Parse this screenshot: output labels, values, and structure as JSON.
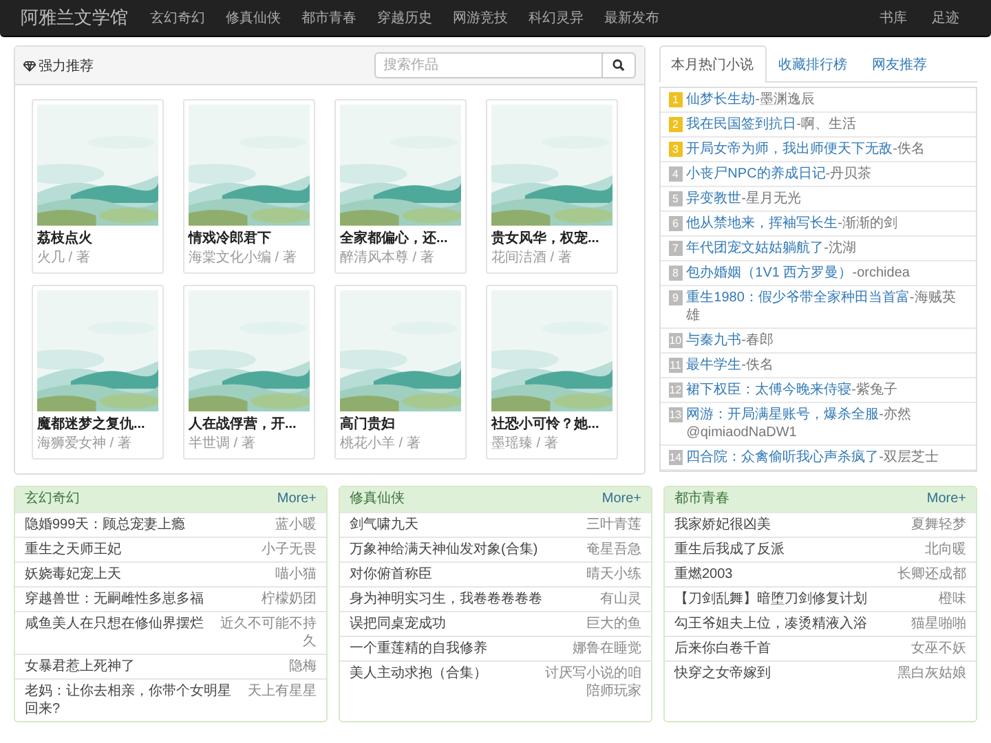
{
  "navbar": {
    "brand": "阿雅兰文学馆",
    "links": [
      "玄幻奇幻",
      "修真仙侠",
      "都市青春",
      "穿越历史",
      "网游竞技",
      "科幻灵异",
      "最新发布"
    ],
    "right_links": [
      "书库",
      "足迹"
    ]
  },
  "recommend": {
    "title": "强力推荐",
    "search": {
      "placeholder": "搜索作品"
    },
    "books": [
      {
        "title": "荔枝点火",
        "author": "火几 / 著"
      },
      {
        "title": "情戏冷郎君下",
        "author": "海棠文化小编 / 著"
      },
      {
        "title": "全家都偏心，还...",
        "author": "醉清风本尊 / 著"
      },
      {
        "title": "贵女风华，权宠...",
        "author": "花间洁酒 / 著"
      },
      {
        "title": "魔都迷梦之复仇...",
        "author": "海狮爱女神 / 著"
      },
      {
        "title": "人在战俘营，开...",
        "author": "半世调 / 著"
      },
      {
        "title": "高门贵妇",
        "author": "桃花小羊 / 著"
      },
      {
        "title": "社恐小可怜？她...",
        "author": "墨瑶臻 / 著"
      }
    ]
  },
  "ranking": {
    "tabs": [
      {
        "label": "本月热门小说",
        "selected": true
      },
      {
        "label": "收藏排行榜",
        "selected": false
      },
      {
        "label": "网友推荐",
        "selected": false
      }
    ],
    "items": [
      {
        "rank": "1",
        "color": "#f0c020",
        "title": "仙梦长生劫",
        "author": "-墨渊逸辰"
      },
      {
        "rank": "2",
        "color": "#f0c020",
        "title": "我在民国签到抗日",
        "author": "-啊、生活"
      },
      {
        "rank": "3",
        "color": "#f0c020",
        "title": "开局女帝为师，我出师便天下无敌",
        "author": "-佚名"
      },
      {
        "rank": "4",
        "color": "#bbbbbb",
        "title": "小丧尸NPC的养成日记",
        "author": "-丹贝茶"
      },
      {
        "rank": "5",
        "color": "#bbbbbb",
        "title": "异变教世",
        "author": "-星月无光"
      },
      {
        "rank": "6",
        "color": "#bbbbbb",
        "title": "他从禁地来，挥袖写长生",
        "author": "-渐渐的剑"
      },
      {
        "rank": "7",
        "color": "#bbbbbb",
        "title": "年代团宠文姑姑躺航了",
        "author": "-沈湖"
      },
      {
        "rank": "8",
        "color": "#bbbbbb",
        "title": "包办婚姻（1V1 西方罗曼）",
        "author": "-orchidea"
      },
      {
        "rank": "9",
        "color": "#bbbbbb",
        "title": "重生1980：假少爷带全家种田当首富",
        "author": "-海贼英雄"
      },
      {
        "rank": "10",
        "color": "#bbbbbb",
        "title": "与秦九书",
        "author": "-春郎"
      },
      {
        "rank": "11",
        "color": "#bbbbbb",
        "title": "最牛学生",
        "author": "-佚名"
      },
      {
        "rank": "12",
        "color": "#bbbbbb",
        "title": "裙下权臣：太傅今晚来侍寝",
        "author": "-紫兔子"
      },
      {
        "rank": "13",
        "color": "#bbbbbb",
        "title": "网游：开局满星账号，爆杀全服",
        "author": "-亦然@qimiaodNaDW1"
      },
      {
        "rank": "14",
        "color": "#bbbbbb",
        "title": "四合院：众禽偷听我心声杀疯了",
        "author": "-双层芝士"
      }
    ]
  },
  "categories": [
    {
      "title": "玄幻奇幻",
      "more": "More+",
      "rows": [
        {
          "title": "隐婚999天：顾总宠妻上瘾",
          "author": "蓝小暖"
        },
        {
          "title": "重生之天师王妃",
          "author": "小子无畏"
        },
        {
          "title": "妖娆毒妃宠上天",
          "author": "喵小猫"
        },
        {
          "title": "穿越兽世：无嗣雌性多崽多福",
          "author": "柠檬奶团"
        },
        {
          "title": "咸鱼美人在只想在修仙界摆烂",
          "author": "近久不可能不持久"
        },
        {
          "title": "女暴君惹上死神了",
          "author": "隐梅"
        },
        {
          "title": "老妈：让你去相亲，你带个女明星回来?",
          "author": "天上有星星"
        }
      ]
    },
    {
      "title": "修真仙侠",
      "more": "More+",
      "rows": [
        {
          "title": "剑气啸九天",
          "author": "三叶青莲"
        },
        {
          "title": "万象神给满天神仙发对象(合集)",
          "author": "奄星吾急"
        },
        {
          "title": "对你俯首称臣",
          "author": "晴天小练"
        },
        {
          "title": "身为神明实习生，我卷卷卷卷卷",
          "author": "有山灵"
        },
        {
          "title": "误把同桌宠成功",
          "author": "巨大的鱼"
        },
        {
          "title": "一个重莲精的自我修养",
          "author": "娜鲁在睡觉"
        },
        {
          "title": "美人主动求抱（合集）",
          "author": "讨厌写小说的咱陪师玩家"
        }
      ]
    },
    {
      "title": "都市青春",
      "more": "More+",
      "rows": [
        {
          "title": "我家娇妃很凶美",
          "author": "夏舞轻梦"
        },
        {
          "title": "重生后我成了反派",
          "author": "北向暖"
        },
        {
          "title": "重燃2003",
          "author": "长卿还成都"
        },
        {
          "title": "【刀剑乱舞】暗堕刀剑修复计划",
          "author": "橙味"
        },
        {
          "title": "勾王爷姐夫上位，凑烫精液入浴",
          "author": "猫星啪啪"
        },
        {
          "title": "后来你白卷千首",
          "author": "女巫不妖"
        },
        {
          "title": "快穿之女帝嫁到",
          "author": "黑白灰姑娘"
        }
      ]
    }
  ]
}
